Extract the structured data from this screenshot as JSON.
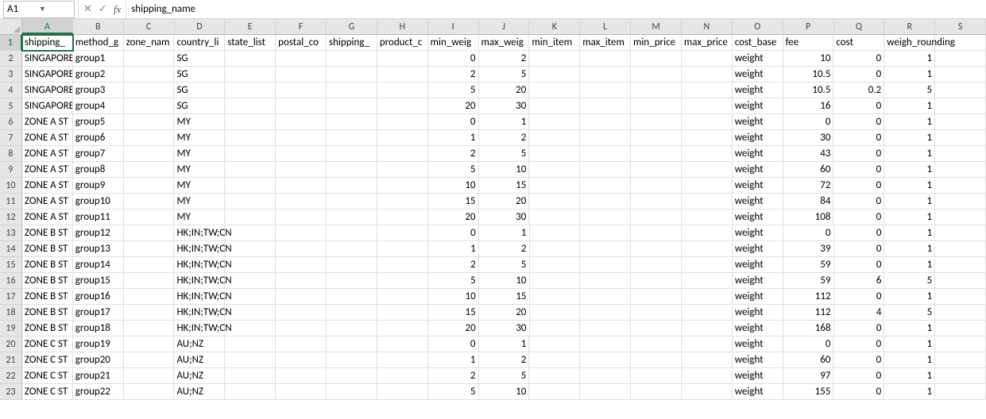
{
  "nameBox": "A1",
  "formulaValue": "shipping_name",
  "columns": [
    "A",
    "B",
    "C",
    "D",
    "E",
    "F",
    "G",
    "H",
    "I",
    "J",
    "K",
    "L",
    "M",
    "N",
    "O",
    "P",
    "Q",
    "R",
    "S"
  ],
  "rowCount": 23,
  "activeCell": {
    "row": 1,
    "col": 0
  },
  "headers": [
    "shipping_name",
    "method_group",
    "zone_name",
    "country_list",
    "state_list",
    "postal_code",
    "shipping_class",
    "product_class",
    "min_weight",
    "max_weight",
    "min_item",
    "max_item",
    "min_price",
    "max_price",
    "cost_base",
    "fee",
    "cost",
    "weigh_rounding",
    ""
  ],
  "headersDisplay": [
    "shipping_",
    "method_g",
    "zone_nam",
    "country_li",
    "state_list",
    "postal_co",
    "shipping_",
    "product_c",
    "min_weig",
    "max_weig",
    "min_item",
    "max_item",
    "min_price",
    "max_price",
    "cost_base",
    "fee",
    "cost",
    "weigh_rounding",
    ""
  ],
  "data": [
    {
      "A": "SINGAPORE",
      "B": "group1",
      "D": "SG",
      "I": "0",
      "J": "2",
      "O": "weight",
      "P": "10",
      "Q": "0",
      "R": "1"
    },
    {
      "A": "SINGAPORE",
      "B": "group2",
      "D": "SG",
      "I": "2",
      "J": "5",
      "O": "weight",
      "P": "10.5",
      "Q": "0",
      "R": "1"
    },
    {
      "A": "SINGAPORE",
      "B": "group3",
      "D": "SG",
      "I": "5",
      "J": "20",
      "O": "weight",
      "P": "10.5",
      "Q": "0.2",
      "R": "5"
    },
    {
      "A": "SINGAPORE",
      "B": "group4",
      "D": "SG",
      "I": "20",
      "J": "30",
      "O": "weight",
      "P": "16",
      "Q": "0",
      "R": "1"
    },
    {
      "A": "ZONE A ST",
      "B": "group5",
      "D": "MY",
      "I": "0",
      "J": "1",
      "O": "weight",
      "P": "0",
      "Q": "0",
      "R": "1"
    },
    {
      "A": "ZONE A ST",
      "B": "group6",
      "D": "MY",
      "I": "1",
      "J": "2",
      "O": "weight",
      "P": "30",
      "Q": "0",
      "R": "1"
    },
    {
      "A": "ZONE A ST",
      "B": "group7",
      "D": "MY",
      "I": "2",
      "J": "5",
      "O": "weight",
      "P": "43",
      "Q": "0",
      "R": "1"
    },
    {
      "A": "ZONE A ST",
      "B": "group8",
      "D": "MY",
      "I": "5",
      "J": "10",
      "O": "weight",
      "P": "60",
      "Q": "0",
      "R": "1"
    },
    {
      "A": "ZONE A ST",
      "B": "group9",
      "D": "MY",
      "I": "10",
      "J": "15",
      "O": "weight",
      "P": "72",
      "Q": "0",
      "R": "1"
    },
    {
      "A": "ZONE A ST",
      "B": "group10",
      "D": "MY",
      "I": "15",
      "J": "20",
      "O": "weight",
      "P": "84",
      "Q": "0",
      "R": "1"
    },
    {
      "A": "ZONE A ST",
      "B": "group11",
      "D": "MY",
      "I": "20",
      "J": "30",
      "O": "weight",
      "P": "108",
      "Q": "0",
      "R": "1"
    },
    {
      "A": "ZONE B ST",
      "B": "group12",
      "D": "HK;IN;TW;CN",
      "I": "0",
      "J": "1",
      "O": "weight",
      "P": "0",
      "Q": "0",
      "R": "1"
    },
    {
      "A": "ZONE B ST",
      "B": "group13",
      "D": "HK;IN;TW;CN",
      "I": "1",
      "J": "2",
      "O": "weight",
      "P": "39",
      "Q": "0",
      "R": "1"
    },
    {
      "A": "ZONE B ST",
      "B": "group14",
      "D": "HK;IN;TW;CN",
      "I": "2",
      "J": "5",
      "O": "weight",
      "P": "59",
      "Q": "0",
      "R": "1"
    },
    {
      "A": "ZONE B ST",
      "B": "group15",
      "D": "HK;IN;TW;CN",
      "I": "5",
      "J": "10",
      "O": "weight",
      "P": "59",
      "Q": "6",
      "R": "5"
    },
    {
      "A": "ZONE B ST",
      "B": "group16",
      "D": "HK;IN;TW;CN",
      "I": "10",
      "J": "15",
      "O": "weight",
      "P": "112",
      "Q": "0",
      "R": "1"
    },
    {
      "A": "ZONE B ST",
      "B": "group17",
      "D": "HK;IN;TW;CN",
      "I": "15",
      "J": "20",
      "O": "weight",
      "P": "112",
      "Q": "4",
      "R": "5"
    },
    {
      "A": "ZONE B ST",
      "B": "group18",
      "D": "HK;IN;TW;CN",
      "I": "20",
      "J": "30",
      "O": "weight",
      "P": "168",
      "Q": "0",
      "R": "1"
    },
    {
      "A": "ZONE C ST",
      "B": "group19",
      "D": "AU;NZ",
      "I": "0",
      "J": "1",
      "O": "weight",
      "P": "0",
      "Q": "0",
      "R": "1"
    },
    {
      "A": "ZONE C ST",
      "B": "group20",
      "D": "AU;NZ",
      "I": "1",
      "J": "2",
      "O": "weight",
      "P": "60",
      "Q": "0",
      "R": "1"
    },
    {
      "A": "ZONE C ST",
      "B": "group21",
      "D": "AU;NZ",
      "I": "2",
      "J": "5",
      "O": "weight",
      "P": "97",
      "Q": "0",
      "R": "1"
    },
    {
      "A": "ZONE C ST",
      "B": "group22",
      "D": "AU;NZ",
      "I": "5",
      "J": "10",
      "O": "weight",
      "P": "155",
      "Q": "0",
      "R": "1"
    }
  ],
  "numericCols": [
    "I",
    "J",
    "P",
    "Q",
    "R"
  ],
  "overflowCols": [
    "D",
    "R"
  ],
  "chart_data": {
    "type": "table",
    "columns": [
      "shipping_name",
      "method_group",
      "zone_name",
      "country_list",
      "state_list",
      "postal_code",
      "shipping_class",
      "product_class",
      "min_weight",
      "max_weight",
      "min_item",
      "max_item",
      "min_price",
      "max_price",
      "cost_base",
      "fee",
      "cost",
      "weigh_rounding"
    ],
    "rows": [
      [
        "SINGAPORE",
        "group1",
        "",
        "SG",
        "",
        "",
        "",
        "",
        0,
        2,
        "",
        "",
        "",
        "",
        "weight",
        10,
        0,
        1
      ],
      [
        "SINGAPORE",
        "group2",
        "",
        "SG",
        "",
        "",
        "",
        "",
        2,
        5,
        "",
        "",
        "",
        "",
        "weight",
        10.5,
        0,
        1
      ],
      [
        "SINGAPORE",
        "group3",
        "",
        "SG",
        "",
        "",
        "",
        "",
        5,
        20,
        "",
        "",
        "",
        "",
        "weight",
        10.5,
        0.2,
        5
      ],
      [
        "SINGAPORE",
        "group4",
        "",
        "SG",
        "",
        "",
        "",
        "",
        20,
        30,
        "",
        "",
        "",
        "",
        "weight",
        16,
        0,
        1
      ],
      [
        "ZONE A ST",
        "group5",
        "",
        "MY",
        "",
        "",
        "",
        "",
        0,
        1,
        "",
        "",
        "",
        "",
        "weight",
        0,
        0,
        1
      ],
      [
        "ZONE A ST",
        "group6",
        "",
        "MY",
        "",
        "",
        "",
        "",
        1,
        2,
        "",
        "",
        "",
        "",
        "weight",
        30,
        0,
        1
      ],
      [
        "ZONE A ST",
        "group7",
        "",
        "MY",
        "",
        "",
        "",
        "",
        2,
        5,
        "",
        "",
        "",
        "",
        "weight",
        43,
        0,
        1
      ],
      [
        "ZONE A ST",
        "group8",
        "",
        "MY",
        "",
        "",
        "",
        "",
        5,
        10,
        "",
        "",
        "",
        "",
        "weight",
        60,
        0,
        1
      ],
      [
        "ZONE A ST",
        "group9",
        "",
        "MY",
        "",
        "",
        "",
        "",
        10,
        15,
        "",
        "",
        "",
        "",
        "weight",
        72,
        0,
        1
      ],
      [
        "ZONE A ST",
        "group10",
        "",
        "MY",
        "",
        "",
        "",
        "",
        15,
        20,
        "",
        "",
        "",
        "",
        "weight",
        84,
        0,
        1
      ],
      [
        "ZONE A ST",
        "group11",
        "",
        "MY",
        "",
        "",
        "",
        "",
        20,
        30,
        "",
        "",
        "",
        "",
        "weight",
        108,
        0,
        1
      ],
      [
        "ZONE B ST",
        "group12",
        "",
        "HK;IN;TW;CN",
        "",
        "",
        "",
        "",
        0,
        1,
        "",
        "",
        "",
        "",
        "weight",
        0,
        0,
        1
      ],
      [
        "ZONE B ST",
        "group13",
        "",
        "HK;IN;TW;CN",
        "",
        "",
        "",
        "",
        1,
        2,
        "",
        "",
        "",
        "",
        "weight",
        39,
        0,
        1
      ],
      [
        "ZONE B ST",
        "group14",
        "",
        "HK;IN;TW;CN",
        "",
        "",
        "",
        "",
        2,
        5,
        "",
        "",
        "",
        "",
        "weight",
        59,
        0,
        1
      ],
      [
        "ZONE B ST",
        "group15",
        "",
        "HK;IN;TW;CN",
        "",
        "",
        "",
        "",
        5,
        10,
        "",
        "",
        "",
        "",
        "weight",
        59,
        6,
        5
      ],
      [
        "ZONE B ST",
        "group16",
        "",
        "HK;IN;TW;CN",
        "",
        "",
        "",
        "",
        10,
        15,
        "",
        "",
        "",
        "",
        "weight",
        112,
        0,
        1
      ],
      [
        "ZONE B ST",
        "group17",
        "",
        "HK;IN;TW;CN",
        "",
        "",
        "",
        "",
        15,
        20,
        "",
        "",
        "",
        "",
        "weight",
        112,
        4,
        5
      ],
      [
        "ZONE B ST",
        "group18",
        "",
        "HK;IN;TW;CN",
        "",
        "",
        "",
        "",
        20,
        30,
        "",
        "",
        "",
        "",
        "weight",
        168,
        0,
        1
      ],
      [
        "ZONE C ST",
        "group19",
        "",
        "AU;NZ",
        "",
        "",
        "",
        "",
        0,
        1,
        "",
        "",
        "",
        "",
        "weight",
        0,
        0,
        1
      ],
      [
        "ZONE C ST",
        "group20",
        "",
        "AU;NZ",
        "",
        "",
        "",
        "",
        1,
        2,
        "",
        "",
        "",
        "",
        "weight",
        60,
        0,
        1
      ],
      [
        "ZONE C ST",
        "group21",
        "",
        "AU;NZ",
        "",
        "",
        "",
        "",
        2,
        5,
        "",
        "",
        "",
        "",
        "weight",
        97,
        0,
        1
      ],
      [
        "ZONE C ST",
        "group22",
        "",
        "AU;NZ",
        "",
        "",
        "",
        "",
        5,
        10,
        "",
        "",
        "",
        "",
        "weight",
        155,
        0,
        1
      ]
    ]
  }
}
